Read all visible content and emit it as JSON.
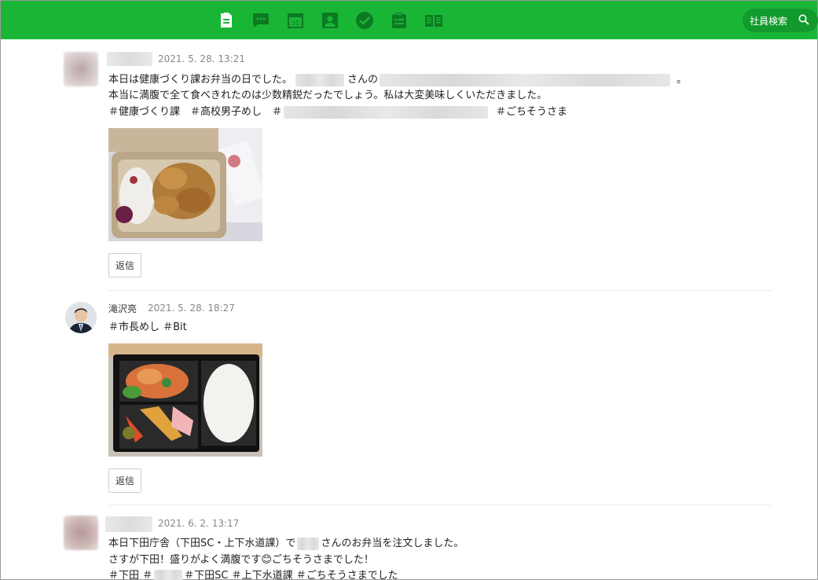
{
  "header": {
    "nav_icons": [
      "note-icon",
      "chat-icon",
      "calendar-icon",
      "contacts-icon",
      "check-icon",
      "clipboard-icon",
      "book-icon"
    ],
    "calendar_day": "31",
    "search_label": "社員検索",
    "accent_color": "#19b636"
  },
  "posts": [
    {
      "timestamp": "2021. 5. 28. 13:21",
      "line1_a": "本日は健康づくり課お弁当の日でした。",
      "line1_b": "さんの",
      "line1_c": "。",
      "line2": "本当に満腹で全て食べきれたのは少数精鋭だったでしょう。私は大変美味しくいただきました。",
      "line3_a": "＃健康づくり課　＃高校男子めし　＃",
      "line3_b": "＃ごちそうさま",
      "reply_label": "返信"
    },
    {
      "author": "滝沢亮",
      "timestamp": "2021. 5. 28. 18:27",
      "line1": "＃市長めし ＃Bit",
      "reply_label": "返信"
    },
    {
      "timestamp": "2021. 6. 2. 13:17",
      "line1_a": "本日下田庁舎（下田SC・上下水道課）で",
      "line1_b": "さんのお弁当を注文しました。",
      "line2": "さすが下田！盛りがよく満腹です😊ごちそうさまでした！",
      "line3_a": "＃下田 ＃",
      "line3_b": "＃下田SC ＃上下水道課 ＃ごちそうさまでした"
    }
  ]
}
